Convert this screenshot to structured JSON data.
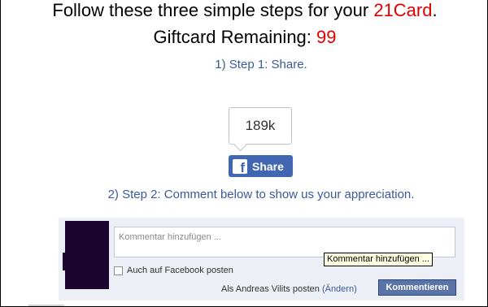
{
  "header": {
    "line1_prefix": "Follow these three simple steps for your ",
    "line1_highlight": "21Card",
    "line1_suffix": ".",
    "line2_prefix": "Giftcard Remaining: ",
    "line2_value": "99"
  },
  "steps": {
    "step1": "1) Step 1: Share.",
    "step2": "2) Step 2: Comment below to show us your appreciation."
  },
  "share": {
    "count": "189k",
    "icon_glyph": "f",
    "button_label": "Share",
    "icon": "facebook-icon"
  },
  "comments": {
    "placeholder": "Kommentar hinzufügen ...",
    "checkbox_label": "Auch auf Facebook posten",
    "post_as_text": "Als Andreas Vilits posten",
    "change_link": "(Ändern)",
    "submit_label": "Kommentieren",
    "tooltip": "Kommentar hinzufügen ..."
  },
  "colors": {
    "highlight": "#e00000",
    "step_text": "#3b5998",
    "facebook_blue": "#4267b2",
    "comment_bg": "#eceff5",
    "submit_button": "#5b74a8"
  }
}
